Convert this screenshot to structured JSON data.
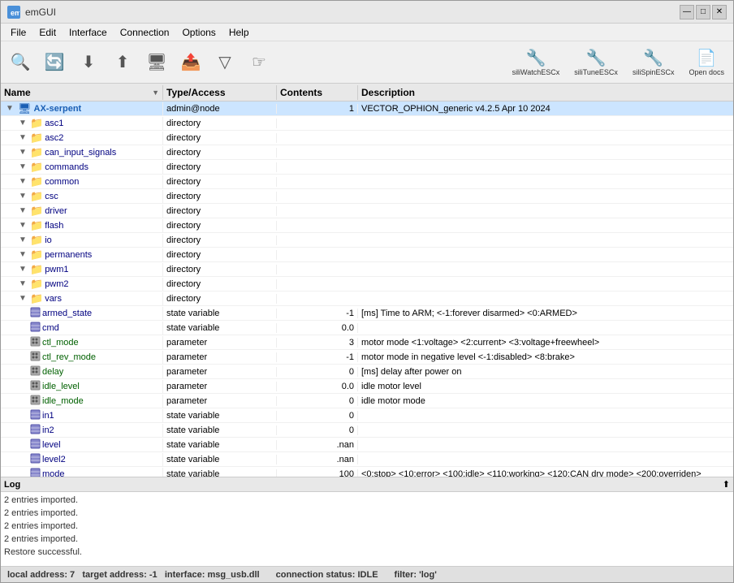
{
  "window": {
    "title": "emGUI",
    "icon": "E"
  },
  "title_bar_controls": {
    "minimize": "—",
    "maximize": "□",
    "close": "✕"
  },
  "menu": {
    "items": [
      "File",
      "Edit",
      "Interface",
      "Connection",
      "Options",
      "Help"
    ]
  },
  "toolbar": {
    "buttons": [
      {
        "icon": "🔍",
        "label": ""
      },
      {
        "icon": "🔄",
        "label": ""
      },
      {
        "icon": "⬇",
        "label": ""
      },
      {
        "icon": "⬆",
        "label": ""
      },
      {
        "icon": "🖥",
        "label": ""
      },
      {
        "icon": "📤",
        "label": ""
      },
      {
        "icon": "▽",
        "label": ""
      },
      {
        "icon": "☞",
        "label": ""
      }
    ],
    "ext_buttons": [
      {
        "label": "siliWatchESCx"
      },
      {
        "label": "siliTuneESCx"
      },
      {
        "label": "siliSpinESCx"
      },
      {
        "label": "Open docs"
      }
    ]
  },
  "table": {
    "headers": [
      "Name",
      "Type/Access",
      "Contents",
      "Description"
    ],
    "rows": [
      {
        "indent": 0,
        "expand": true,
        "type": "root",
        "name": "AX-serpent",
        "access": "admin@node",
        "contents": "1",
        "desc": "VECTOR_OPHION_generic v4.2.5 Apr 10 2024",
        "color": "blue"
      },
      {
        "indent": 1,
        "expand": true,
        "type": "folder",
        "name": "asc1",
        "access": "directory",
        "contents": "",
        "desc": ""
      },
      {
        "indent": 1,
        "expand": true,
        "type": "folder",
        "name": "asc2",
        "access": "directory",
        "contents": "",
        "desc": ""
      },
      {
        "indent": 1,
        "expand": true,
        "type": "folder",
        "name": "can_input_signals",
        "access": "directory",
        "contents": "",
        "desc": ""
      },
      {
        "indent": 1,
        "expand": true,
        "type": "folder",
        "name": "commands",
        "access": "directory",
        "contents": "",
        "desc": ""
      },
      {
        "indent": 1,
        "expand": true,
        "type": "folder",
        "name": "common",
        "access": "directory",
        "contents": "",
        "desc": ""
      },
      {
        "indent": 1,
        "expand": true,
        "type": "folder",
        "name": "csc",
        "access": "directory",
        "contents": "",
        "desc": ""
      },
      {
        "indent": 1,
        "expand": true,
        "type": "folder",
        "name": "driver",
        "access": "directory",
        "contents": "",
        "desc": ""
      },
      {
        "indent": 1,
        "expand": true,
        "type": "folder",
        "name": "flash",
        "access": "directory",
        "contents": "",
        "desc": ""
      },
      {
        "indent": 1,
        "expand": true,
        "type": "folder",
        "name": "io",
        "access": "directory",
        "contents": "",
        "desc": ""
      },
      {
        "indent": 1,
        "expand": true,
        "type": "folder",
        "name": "permanents",
        "access": "directory",
        "contents": "",
        "desc": ""
      },
      {
        "indent": 1,
        "expand": true,
        "type": "folder",
        "name": "pwm1",
        "access": "directory",
        "contents": "",
        "desc": ""
      },
      {
        "indent": 1,
        "expand": true,
        "type": "folder",
        "name": "pwm2",
        "access": "directory",
        "contents": "",
        "desc": ""
      },
      {
        "indent": 1,
        "expand": true,
        "type": "folder",
        "name": "vars",
        "access": "directory",
        "contents": "",
        "desc": ""
      },
      {
        "indent": 1,
        "expand": false,
        "type": "statevar",
        "name": "armed_state",
        "access": "state variable",
        "contents": "-1",
        "desc": "[ms] Time to ARM; <-1:forever disarmed> <0:ARMED>"
      },
      {
        "indent": 1,
        "expand": false,
        "type": "statevar",
        "name": "cmd",
        "access": "state variable",
        "contents": "0.0",
        "desc": ""
      },
      {
        "indent": 1,
        "expand": false,
        "type": "param",
        "name": "ctl_mode",
        "access": "parameter",
        "contents": "3",
        "desc": "motor mode <1:voltage> <2:current> <3:voltage+freewheel>"
      },
      {
        "indent": 1,
        "expand": false,
        "type": "param",
        "name": "ctl_rev_mode",
        "access": "parameter",
        "contents": "-1",
        "desc": "motor mode in negative level <-1:disabled> <8:brake>"
      },
      {
        "indent": 1,
        "expand": false,
        "type": "param",
        "name": "delay",
        "access": "parameter",
        "contents": "0",
        "desc": "[ms] delay after power on"
      },
      {
        "indent": 1,
        "expand": false,
        "type": "param",
        "name": "idle_level",
        "access": "parameter",
        "contents": "0.0",
        "desc": "idle motor level"
      },
      {
        "indent": 1,
        "expand": false,
        "type": "param",
        "name": "idle_mode",
        "access": "parameter",
        "contents": "0",
        "desc": "idle motor mode"
      },
      {
        "indent": 1,
        "expand": false,
        "type": "statevar",
        "name": "in1",
        "access": "state variable",
        "contents": "0",
        "desc": ""
      },
      {
        "indent": 1,
        "expand": false,
        "type": "statevar",
        "name": "in2",
        "access": "state variable",
        "contents": "0",
        "desc": ""
      },
      {
        "indent": 1,
        "expand": false,
        "type": "statevar",
        "name": "level",
        "access": "state variable",
        "contents": ".nan",
        "desc": ""
      },
      {
        "indent": 1,
        "expand": false,
        "type": "statevar",
        "name": "level2",
        "access": "state variable",
        "contents": ".nan",
        "desc": ""
      },
      {
        "indent": 1,
        "expand": false,
        "type": "statevar",
        "name": "mode",
        "access": "state variable",
        "contents": "100",
        "desc": "<0:stop> <10:error> <100:idle> <110:working> <120:CAN drv mode> <200:overriden>"
      }
    ]
  },
  "log": {
    "title": "Log",
    "entries": [
      "2 entries imported.",
      "2 entries imported.",
      "2 entries imported.",
      "2 entries imported.",
      "Restore successful."
    ]
  },
  "status_bar": {
    "local_address_label": "local address:",
    "local_address_value": "7",
    "target_address_label": "target address:",
    "target_address_value": "-1",
    "interface_label": "interface:",
    "interface_value": "msg_usb.dll",
    "connection_label": "connection status:",
    "connection_value": "IDLE",
    "filter_label": "filter:",
    "filter_value": "'log'"
  }
}
